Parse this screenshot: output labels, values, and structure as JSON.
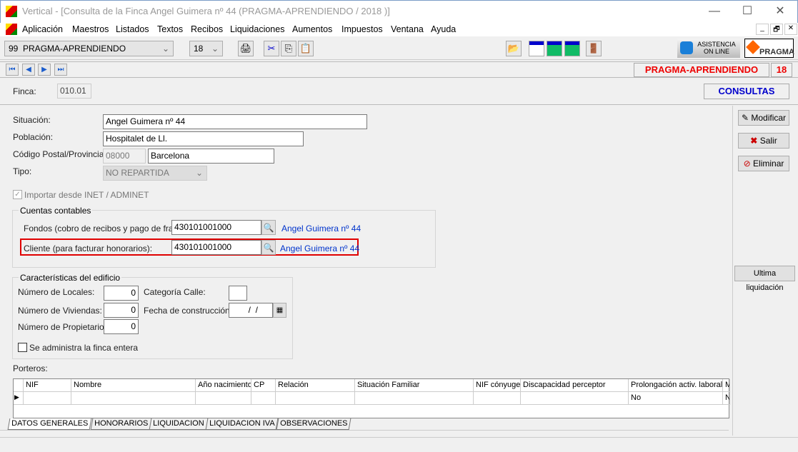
{
  "window": {
    "title": "Vertical - [Consulta de la Finca Angel Guimera nº 44 (PRAGMA-APRENDIENDO / 2018 )]",
    "minimize": "—",
    "maximize": "☐",
    "close": "✕",
    "mdi_minimize": "_",
    "mdi_restore": "🗗",
    "mdi_close": "✕"
  },
  "menu": [
    {
      "label": "Aplicación",
      "u": "A"
    },
    {
      "label": "Maestros",
      "u": "M"
    },
    {
      "label": "Listados",
      "u": "L"
    },
    {
      "label": "Textos",
      "u": "T"
    },
    {
      "label": "Recibos",
      "u": "R"
    },
    {
      "label": "Liquidaciones",
      "u": "L"
    },
    {
      "label": "Aumentos",
      "u": "u"
    },
    {
      "label": "Impuestos",
      "u": "I"
    },
    {
      "label": "Ventana",
      "u": "V"
    },
    {
      "label": "Ayuda",
      "u": "y"
    }
  ],
  "toolbar": {
    "company": "99  PRAGMA-APRENDIENDO",
    "year": "18",
    "asistencia_line1": "ASISTENCIA",
    "asistencia_line2": "ON LINE",
    "pragma_logo": "PRAGMA"
  },
  "nav": {
    "company": "PRAGMA-APRENDIENDO",
    "year": "18"
  },
  "header": {
    "finca_label": "Finca:",
    "finca_value": "010.01",
    "mode": "CONSULTAS"
  },
  "form": {
    "situacion_label": "Situación:",
    "situacion": "Angel Guimera nº 44",
    "poblacion_label": "Población:",
    "poblacion": "Hospitalet de Ll.",
    "cp_label": "Código Postal/Provincia:",
    "cp": "08000",
    "provincia": "Barcelona",
    "tipo_label": "Tipo:",
    "tipo": "NO REPARTIDA",
    "importar_label": "Importar desde INET / ADMINET",
    "importar_checked": true
  },
  "cuentas": {
    "title": "Cuentas contables",
    "fondos_label": "Fondos (cobro de recibos y pago de fras.):",
    "fondos": "430101001000",
    "fondos_name": "Angel Guimera nº 44",
    "cliente_label": "Cliente (para facturar honorarios):",
    "cliente": "430101001000",
    "cliente_name": "Angel Guimera nº 44",
    "highlight_color": "#e00000"
  },
  "edificio": {
    "title": "Características del edificio",
    "locales_label": "Número de Locales:",
    "locales": "0",
    "viviendas_label": "Número de Viviendas:",
    "viviendas": "0",
    "propietarios_label": "Número de Propietarios:",
    "propietarios": "0",
    "categoria_label": "Categoría Calle:",
    "categoria": "",
    "fecha_label": "Fecha de construcción:",
    "fecha": "  /  /",
    "finca_entera_label": "Se administra la finca entera",
    "finca_entera_checked": false
  },
  "porteros": {
    "label": "Porteros:",
    "columns": [
      "NIF",
      "Nombre",
      "Año nacimiento",
      "CP",
      "Relación",
      "Situación Familiar",
      "NIF cónyuge",
      "Discapacidad  perceptor",
      "Prolongación activ. laboral",
      "M"
    ],
    "rows": [
      [
        "",
        "",
        "",
        "",
        "",
        "",
        "",
        "",
        "No",
        "N"
      ]
    ]
  },
  "actions": {
    "modificar": "Modificar",
    "salir": "Salir",
    "eliminar": "Eliminar",
    "ultima": "Ultima liquidación"
  },
  "tabs": [
    "DATOS GENERALES",
    "HONORARIOS",
    "LIQUIDACION",
    "LIQUIDACION IVA",
    "OBSERVACIONES"
  ]
}
